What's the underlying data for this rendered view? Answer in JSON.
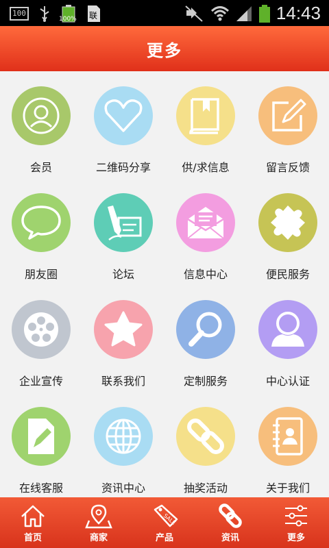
{
  "status_bar": {
    "left_box": "100",
    "battery_pct": "100%",
    "time": "14:43"
  },
  "header": {
    "title": "更多"
  },
  "grid": {
    "items": [
      {
        "label": "会员",
        "icon": "user-icon",
        "color": "#a8c86a"
      },
      {
        "label": "二维码分享",
        "icon": "heart-icon",
        "color": "#a9dcf3"
      },
      {
        "label": "供/求信息",
        "icon": "book-icon",
        "color": "#f5e08a"
      },
      {
        "label": "留言反馈",
        "icon": "edit-icon",
        "color": "#f7be7c"
      },
      {
        "label": "朋友圈",
        "icon": "chat-bubble-icon",
        "color": "#9fd36e"
      },
      {
        "label": "论坛",
        "icon": "pen-paper-icon",
        "color": "#5ecdb6"
      },
      {
        "label": "信息中心",
        "icon": "envelope-icon",
        "color": "#f39de0"
      },
      {
        "label": "便民服务",
        "icon": "puzzle-icon",
        "color": "#c6c455"
      },
      {
        "label": "企业宣传",
        "icon": "film-reel-icon",
        "color": "#c0c6cf"
      },
      {
        "label": "联系我们",
        "icon": "star-icon",
        "color": "#f7a3ad"
      },
      {
        "label": "定制服务",
        "icon": "magnifier-icon",
        "color": "#8fb2e6"
      },
      {
        "label": "中心认证",
        "icon": "person-badge-icon",
        "color": "#b39df3"
      },
      {
        "label": "在线客服",
        "icon": "document-edit-icon",
        "color": "#9fd36e"
      },
      {
        "label": "资讯中心",
        "icon": "globe-icon",
        "color": "#a9dcf3"
      },
      {
        "label": "抽奖活动",
        "icon": "chain-link-icon",
        "color": "#f5e08a"
      },
      {
        "label": "关于我们",
        "icon": "contacts-book-icon",
        "color": "#f7be7c"
      }
    ]
  },
  "tabbar": {
    "items": [
      {
        "label": "首页",
        "icon": "home-icon"
      },
      {
        "label": "商家",
        "icon": "map-pin-icon"
      },
      {
        "label": "产品",
        "icon": "sale-tag-icon"
      },
      {
        "label": "资讯",
        "icon": "link-icon"
      },
      {
        "label": "更多",
        "icon": "sliders-icon"
      }
    ]
  }
}
